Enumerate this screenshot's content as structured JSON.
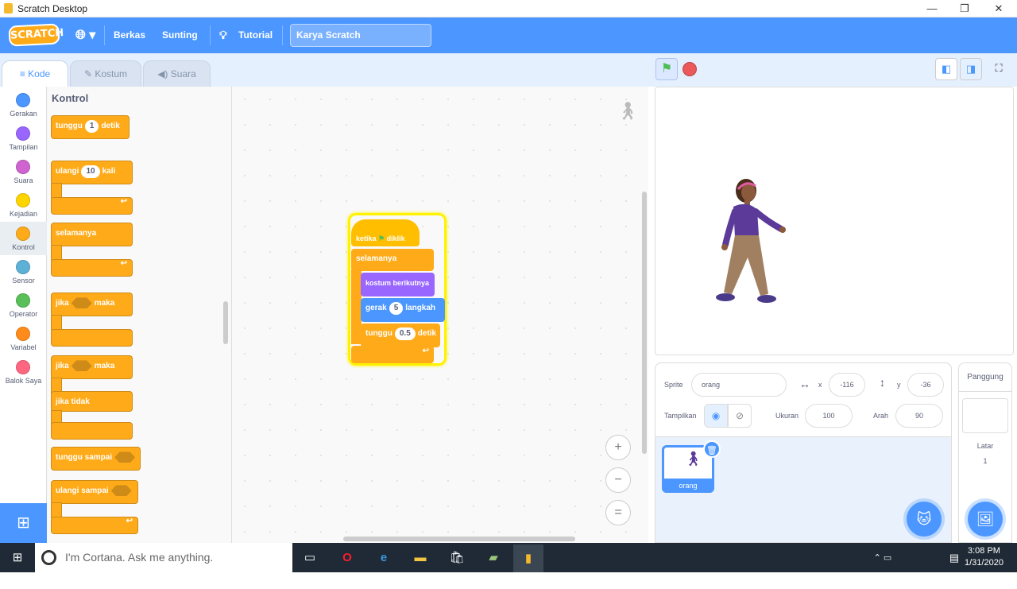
{
  "window": {
    "title": "Scratch Desktop",
    "controls": [
      "—",
      "❐",
      "✕"
    ]
  },
  "menubar": {
    "logo": "SCRATCH",
    "globe_icon": "globe-icon",
    "file": "Berkas",
    "edit": "Sunting",
    "tutorial": "Tutorial",
    "project_title": "Karya Scratch"
  },
  "tabs": [
    {
      "label": "Kode",
      "active": true
    },
    {
      "label": "Kostum",
      "active": false
    },
    {
      "label": "Suara",
      "active": false
    }
  ],
  "categories": [
    {
      "label": "Gerakan",
      "color": "#4c97ff"
    },
    {
      "label": "Tampilan",
      "color": "#9966ff"
    },
    {
      "label": "Suara",
      "color": "#cf63cf"
    },
    {
      "label": "Kejadian",
      "color": "#ffd500"
    },
    {
      "label": "Kontrol",
      "color": "#ffab19",
      "selected": true
    },
    {
      "label": "Sensor",
      "color": "#5cb1d6"
    },
    {
      "label": "Operator",
      "color": "#59c059"
    },
    {
      "label": "Variabel",
      "color": "#ff8c1a"
    },
    {
      "label": "Balok Saya",
      "color": "#ff6680"
    }
  ],
  "palette": {
    "heading": "Kontrol",
    "wait": {
      "text1": "tunggu",
      "value": "1",
      "text2": "detik"
    },
    "repeat": {
      "text1": "ulangi",
      "value": "10",
      "text2": "kali"
    },
    "forever": "selamanya",
    "if_then": {
      "text1": "jika",
      "text2": "maka"
    },
    "if_else": {
      "text1": "jika",
      "text2": "maka",
      "else": "jika tidak"
    },
    "wait_until": "tunggu sampai",
    "repeat_until": "ulangi sampai"
  },
  "script": {
    "hat": {
      "text1": "ketika",
      "text2": "diklik"
    },
    "forever": "selamanya",
    "next_costume": "kostum berikutnya",
    "move": {
      "text1": "gerak",
      "value": "5",
      "text2": "langkah"
    },
    "wait": {
      "text1": "tunggu",
      "value": "0.5",
      "text2": "detik"
    }
  },
  "zoom": {
    "in": "+",
    "out": "−",
    "reset": "="
  },
  "sprite_info": {
    "sprite_label": "Sprite",
    "sprite_name": "orang",
    "x_label": "x",
    "x": "-116",
    "y_label": "y",
    "y": "-36",
    "show_label": "Tampilkan",
    "size_label": "Ukuran",
    "size": "100",
    "direction_label": "Arah",
    "direction": "90"
  },
  "sprite_list": [
    {
      "name": "orang"
    }
  ],
  "stage_panel": {
    "title": "Panggung",
    "backdrops_label": "Latar",
    "backdrops_count": "1"
  },
  "taskbar": {
    "search_placeholder": "I'm Cortana. Ask me anything.",
    "time": "3:08 PM",
    "date": "1/31/2020"
  },
  "colors": {
    "accent": "#4c97ff",
    "control": "#ffab19",
    "looks": "#9966ff",
    "motion": "#4c97ff",
    "highlight": "#fff200"
  }
}
